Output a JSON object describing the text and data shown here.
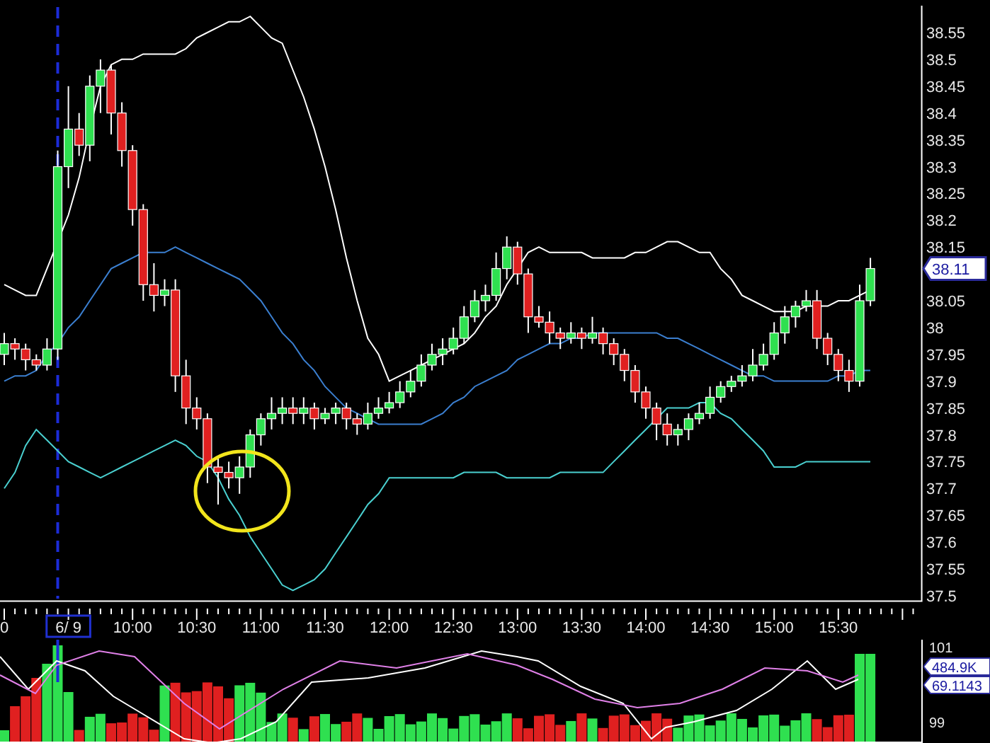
{
  "price_panel": {
    "last_price": "38.11",
    "time_axis": {
      "edge_label": "0",
      "date_label": {
        "text": "6/ 9",
        "selected": true
      }
    },
    "chart_data": {
      "type": "candlestick",
      "x": [
        540,
        545,
        550,
        555,
        560,
        565,
        570,
        575,
        580,
        585,
        590,
        595,
        600,
        605,
        610,
        615,
        620,
        625,
        630,
        635,
        640,
        645,
        650,
        655,
        660,
        665,
        670,
        675,
        680,
        685,
        690,
        695,
        700,
        705,
        710,
        715,
        720,
        725,
        730,
        735,
        740,
        745,
        750,
        755,
        760,
        765,
        770,
        775,
        780,
        785,
        790,
        795,
        800,
        805,
        810,
        815,
        820,
        825,
        830,
        835,
        840,
        845,
        850,
        855,
        860,
        865,
        870,
        875,
        880,
        885,
        890,
        895,
        900,
        905,
        910,
        915,
        920,
        925,
        930,
        935,
        940,
        945
      ],
      "ohlc": [
        [
          37.95,
          37.99,
          37.93,
          37.97
        ],
        [
          37.97,
          37.98,
          37.94,
          37.96
        ],
        [
          37.96,
          37.97,
          37.92,
          37.94
        ],
        [
          37.94,
          37.95,
          37.92,
          37.93
        ],
        [
          37.93,
          37.98,
          37.92,
          37.96
        ],
        [
          37.96,
          38.33,
          37.94,
          38.3
        ],
        [
          38.3,
          38.45,
          38.26,
          38.37
        ],
        [
          38.37,
          38.4,
          38.32,
          38.34
        ],
        [
          38.34,
          38.47,
          38.31,
          38.45
        ],
        [
          38.45,
          38.5,
          38.4,
          38.48
        ],
        [
          38.48,
          38.49,
          38.36,
          38.4
        ],
        [
          38.4,
          38.42,
          38.3,
          38.33
        ],
        [
          38.33,
          38.34,
          38.19,
          38.22
        ],
        [
          38.22,
          38.23,
          38.05,
          38.08
        ],
        [
          38.08,
          38.12,
          38.03,
          38.06
        ],
        [
          38.06,
          38.09,
          38.04,
          38.07
        ],
        [
          38.07,
          38.09,
          37.88,
          37.91
        ],
        [
          37.91,
          37.94,
          37.82,
          37.85
        ],
        [
          37.85,
          37.87,
          37.81,
          37.83
        ],
        [
          37.83,
          37.84,
          37.71,
          37.74
        ],
        [
          37.74,
          37.76,
          37.67,
          37.73
        ],
        [
          37.73,
          37.75,
          37.7,
          37.72
        ],
        [
          37.72,
          37.76,
          37.69,
          37.74
        ],
        [
          37.74,
          37.81,
          37.72,
          37.8
        ],
        [
          37.8,
          37.84,
          37.78,
          37.83
        ],
        [
          37.83,
          37.87,
          37.81,
          37.84
        ],
        [
          37.84,
          37.87,
          37.82,
          37.85
        ],
        [
          37.85,
          37.87,
          37.82,
          37.84
        ],
        [
          37.84,
          37.87,
          37.82,
          37.85
        ],
        [
          37.85,
          37.86,
          37.81,
          37.83
        ],
        [
          37.83,
          37.85,
          37.82,
          37.84
        ],
        [
          37.84,
          37.86,
          37.82,
          37.85
        ],
        [
          37.85,
          37.86,
          37.81,
          37.83
        ],
        [
          37.83,
          37.84,
          37.8,
          37.82
        ],
        [
          37.82,
          37.86,
          37.81,
          37.84
        ],
        [
          37.84,
          37.87,
          37.83,
          37.85
        ],
        [
          37.85,
          37.88,
          37.84,
          37.86
        ],
        [
          37.86,
          37.9,
          37.85,
          37.88
        ],
        [
          37.88,
          37.92,
          37.87,
          37.9
        ],
        [
          37.9,
          37.95,
          37.89,
          37.93
        ],
        [
          37.93,
          37.97,
          37.92,
          37.95
        ],
        [
          37.95,
          37.98,
          37.93,
          37.96
        ],
        [
          37.96,
          38.0,
          37.95,
          37.98
        ],
        [
          37.98,
          38.04,
          37.97,
          38.02
        ],
        [
          38.02,
          38.07,
          38.01,
          38.05
        ],
        [
          38.05,
          38.08,
          38.03,
          38.06
        ],
        [
          38.06,
          38.14,
          38.05,
          38.11
        ],
        [
          38.11,
          38.17,
          38.09,
          38.15
        ],
        [
          38.15,
          38.16,
          38.08,
          38.1
        ],
        [
          38.1,
          38.11,
          37.99,
          38.02
        ],
        [
          38.02,
          38.04,
          38.0,
          38.01
        ],
        [
          38.01,
          38.03,
          37.97,
          37.99
        ],
        [
          37.99,
          38.0,
          37.96,
          37.98
        ],
        [
          37.98,
          38.01,
          37.97,
          37.99
        ],
        [
          37.99,
          38.0,
          37.96,
          37.98
        ],
        [
          37.98,
          38.02,
          37.97,
          37.99
        ],
        [
          37.99,
          38.0,
          37.95,
          37.97
        ],
        [
          37.97,
          37.98,
          37.93,
          37.95
        ],
        [
          37.95,
          37.96,
          37.9,
          37.92
        ],
        [
          37.92,
          37.93,
          37.86,
          37.88
        ],
        [
          37.88,
          37.89,
          37.83,
          37.85
        ],
        [
          37.85,
          37.86,
          37.79,
          37.82
        ],
        [
          37.82,
          37.84,
          37.78,
          37.8
        ],
        [
          37.8,
          37.82,
          37.78,
          37.81
        ],
        [
          37.81,
          37.84,
          37.79,
          37.83
        ],
        [
          37.83,
          37.86,
          37.82,
          37.84
        ],
        [
          37.84,
          37.89,
          37.83,
          37.87
        ],
        [
          37.87,
          37.9,
          37.86,
          37.89
        ],
        [
          37.89,
          37.91,
          37.88,
          37.9
        ],
        [
          37.9,
          37.93,
          37.89,
          37.91
        ],
        [
          37.91,
          37.96,
          37.9,
          37.93
        ],
        [
          37.93,
          37.97,
          37.92,
          37.95
        ],
        [
          37.95,
          38.01,
          37.94,
          37.99
        ],
        [
          37.99,
          38.04,
          37.97,
          38.02
        ],
        [
          38.02,
          38.05,
          38.0,
          38.04
        ],
        [
          38.04,
          38.07,
          38.03,
          38.05
        ],
        [
          38.05,
          38.07,
          37.96,
          37.98
        ],
        [
          37.98,
          37.99,
          37.93,
          37.95
        ],
        [
          37.95,
          37.96,
          37.9,
          37.92
        ],
        [
          37.92,
          37.94,
          37.88,
          37.9
        ],
        [
          37.9,
          38.08,
          37.89,
          38.05
        ],
        [
          38.05,
          38.13,
          38.04,
          38.11
        ]
      ],
      "series": [
        {
          "type": "line",
          "color": "#ffffff",
          "values": [
            38.08,
            38.07,
            38.06,
            38.06,
            38.11,
            38.16,
            38.21,
            38.28,
            38.37,
            38.45,
            38.49,
            38.5,
            38.5,
            38.51,
            38.51,
            38.51,
            38.51,
            38.52,
            38.54,
            38.55,
            38.56,
            38.57,
            38.57,
            38.58,
            38.56,
            38.54,
            38.53,
            38.48,
            38.43,
            38.37,
            38.3,
            38.22,
            38.13,
            38.05,
            37.98,
            37.95,
            37.9,
            37.91,
            37.92,
            37.93,
            37.94,
            37.95,
            37.96,
            37.97,
            37.99,
            38.02,
            38.04,
            38.08,
            38.11,
            38.14,
            38.15,
            38.14,
            38.14,
            38.14,
            38.14,
            38.13,
            38.13,
            38.13,
            38.13,
            38.14,
            38.14,
            38.15,
            38.16,
            38.16,
            38.15,
            38.14,
            38.14,
            38.11,
            38.09,
            38.06,
            38.05,
            38.04,
            38.03,
            38.03,
            38.03,
            38.04,
            38.04,
            38.04,
            38.05,
            38.05,
            38.06,
            38.07
          ]
        },
        {
          "type": "line",
          "color": "#3b7fd0",
          "values": [
            37.9,
            37.91,
            37.91,
            37.92,
            37.95,
            37.97,
            38.0,
            38.02,
            38.05,
            38.08,
            38.11,
            38.12,
            38.13,
            38.14,
            38.14,
            38.14,
            38.15,
            38.14,
            38.13,
            38.12,
            38.11,
            38.1,
            38.09,
            38.07,
            38.05,
            38.02,
            37.99,
            37.97,
            37.94,
            37.92,
            37.89,
            37.87,
            37.85,
            37.84,
            37.83,
            37.82,
            37.82,
            37.82,
            37.82,
            37.82,
            37.83,
            37.84,
            37.86,
            37.87,
            37.89,
            37.9,
            37.91,
            37.92,
            37.94,
            37.95,
            37.96,
            37.97,
            37.97,
            37.98,
            37.98,
            37.99,
            37.99,
            37.99,
            37.99,
            37.99,
            37.99,
            37.99,
            37.98,
            37.98,
            37.97,
            37.96,
            37.95,
            37.94,
            37.93,
            37.92,
            37.91,
            37.91,
            37.9,
            37.9,
            37.9,
            37.9,
            37.9,
            37.9,
            37.91,
            37.91,
            37.92,
            37.92
          ]
        },
        {
          "type": "line",
          "color": "#4ad0d0",
          "values": [
            37.7,
            37.73,
            37.78,
            37.81,
            37.79,
            37.77,
            37.75,
            37.74,
            37.73,
            37.72,
            37.73,
            37.74,
            37.75,
            37.76,
            37.77,
            37.78,
            37.79,
            37.78,
            37.76,
            37.75,
            37.72,
            37.68,
            37.65,
            37.61,
            37.58,
            37.55,
            37.52,
            37.51,
            37.52,
            37.53,
            37.55,
            37.58,
            37.61,
            37.64,
            37.67,
            37.69,
            37.72,
            37.72,
            37.72,
            37.72,
            37.72,
            37.72,
            37.72,
            37.73,
            37.73,
            37.73,
            37.73,
            37.72,
            37.72,
            37.72,
            37.72,
            37.72,
            37.73,
            37.73,
            37.73,
            37.73,
            37.73,
            37.75,
            37.77,
            37.79,
            37.81,
            37.83,
            37.85,
            37.85,
            37.85,
            37.86,
            37.86,
            37.84,
            37.83,
            37.81,
            37.79,
            37.77,
            37.74,
            37.74,
            37.74,
            37.75,
            37.75,
            37.75,
            37.75,
            37.75,
            37.75,
            37.75
          ]
        }
      ],
      "yticks": [
        38.55,
        38.5,
        38.45,
        38.4,
        38.35,
        38.3,
        38.25,
        38.2,
        38.15,
        38.05,
        38,
        37.95,
        37.9,
        37.85,
        37.8,
        37.75,
        37.7,
        37.65,
        37.6,
        37.55,
        37.5
      ],
      "xticks": [
        {
          "value": 600,
          "label": "10:00"
        },
        {
          "value": 630,
          "label": "10:30"
        },
        {
          "value": 660,
          "label": "11:00"
        },
        {
          "value": 690,
          "label": "11:30"
        },
        {
          "value": 720,
          "label": "12:00"
        },
        {
          "value": 750,
          "label": "12:30"
        },
        {
          "value": 780,
          "label": "13:00"
        },
        {
          "value": 810,
          "label": "13:30"
        },
        {
          "value": 840,
          "label": "14:00"
        },
        {
          "value": 870,
          "label": "14:30"
        },
        {
          "value": 900,
          "label": "15:00"
        },
        {
          "value": 930,
          "label": "15:30"
        }
      ],
      "xlim": [
        538,
        969
      ],
      "ylim": [
        37.49,
        38.6
      ],
      "ref_lines": [
        {
          "axis": "x",
          "value": 565,
          "color": "#1c2cd8"
        }
      ]
    }
  },
  "volume_panel": {
    "axis_labels": [
      {
        "text": "101",
        "kind": "top"
      },
      {
        "text": "99",
        "kind": "bottom"
      }
    ],
    "readouts": [
      "484.9K",
      "69.1143"
    ]
  }
}
